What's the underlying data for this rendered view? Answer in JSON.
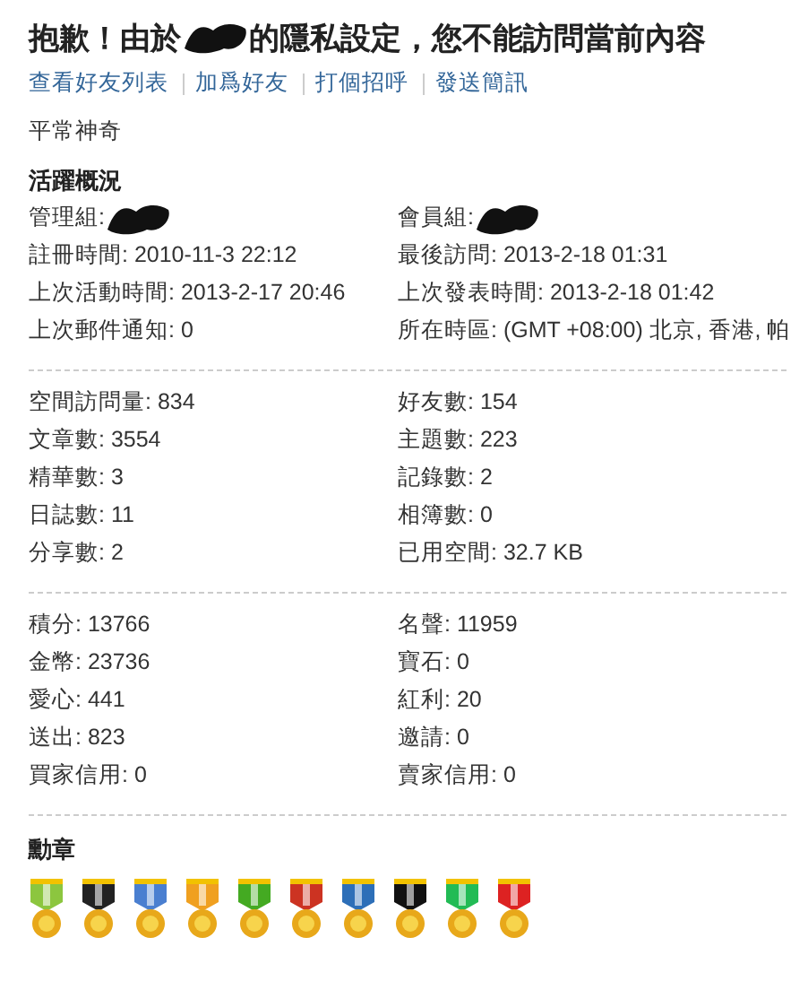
{
  "title": {
    "before": "抱歉！由於",
    "after": "的隱私設定，您不能訪問當前內容"
  },
  "links": [
    "查看好友列表",
    "加爲好友",
    "打個招呼",
    "發送簡訊"
  ],
  "signature": "平常神奇",
  "activity": {
    "heading": "活躍概況",
    "groups": [
      {
        "label": "管理組:"
      },
      {
        "label": "會員組:"
      }
    ],
    "rows": [
      "註冊時間: 2010-11-3 22:12",
      "最後訪問: 2013-2-18 01:31",
      "上次活動時間: 2013-2-17 20:46",
      "上次發表時間: 2013-2-18 01:42",
      "上次郵件通知: 0",
      "所在時區: (GMT +08:00) 北京, 香港, 帕"
    ]
  },
  "stats": [
    "空間訪問量: 834",
    "好友數: 154",
    "文章數: 3554",
    "主題數: 223",
    "精華數: 3",
    "記錄數: 2",
    "日誌數: 11",
    "相簿數: 0",
    "分享數: 2",
    "已用空間: 32.7 KB"
  ],
  "credits": [
    "積分: 13766",
    "名聲: 11959",
    "金幣: 23736",
    "寶石: 0",
    "愛心: 441",
    "紅利: 20",
    "送出: 823",
    "邀請: 0",
    "買家信用: 0",
    "賣家信用: 0"
  ],
  "medals": {
    "heading": "勳章",
    "items": [
      {
        "color": "#8cc63f"
      },
      {
        "color": "#222222"
      },
      {
        "color": "#4a7fd0"
      },
      {
        "color": "#f0a020"
      },
      {
        "color": "#44aa22"
      },
      {
        "color": "#cc3322"
      },
      {
        "color": "#2d6fb8"
      },
      {
        "color": "#111111"
      },
      {
        "color": "#22bb55"
      },
      {
        "color": "#dd2222"
      }
    ]
  }
}
